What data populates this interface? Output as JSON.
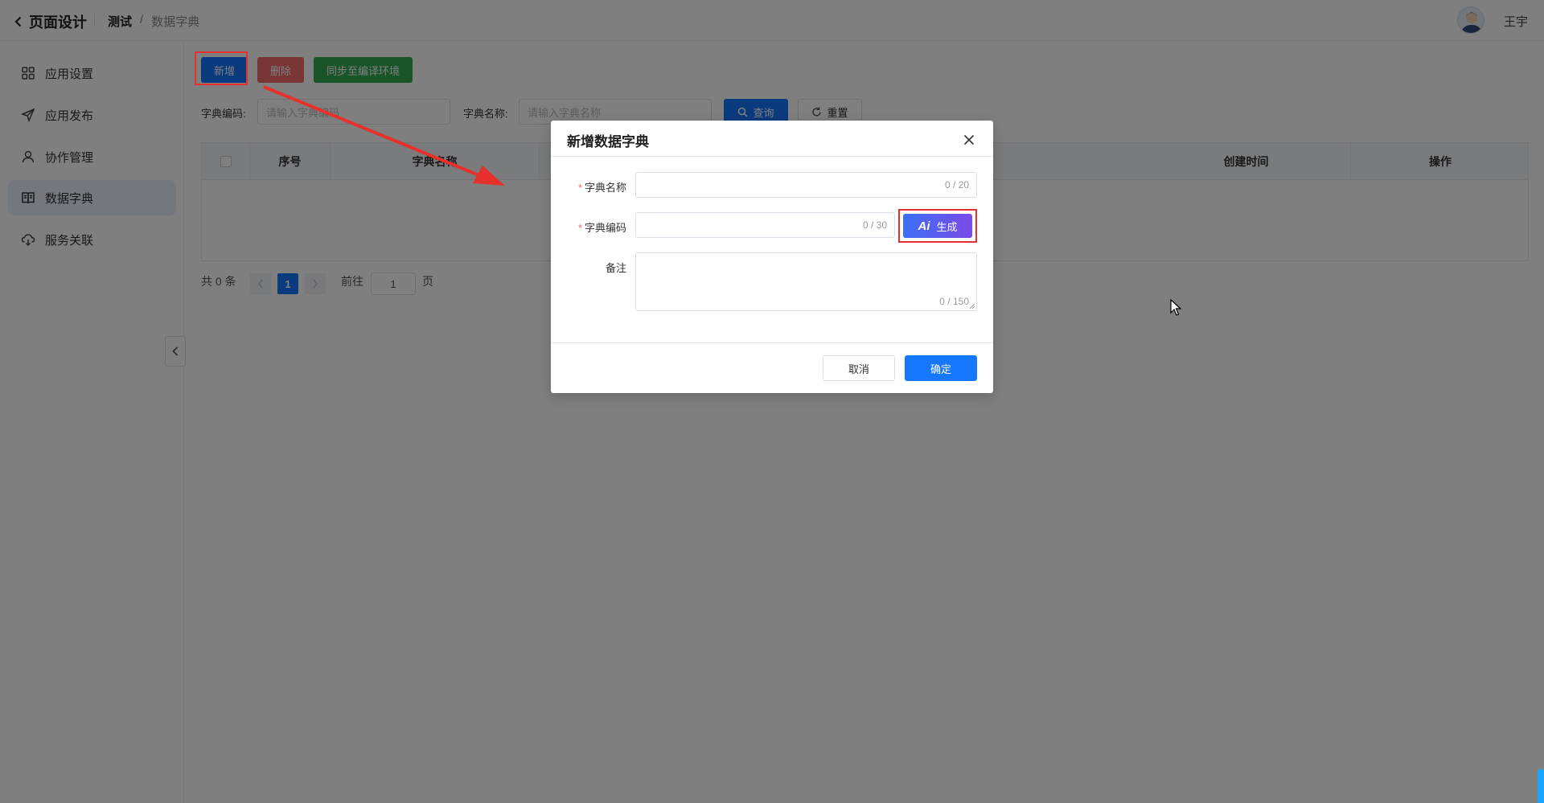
{
  "header": {
    "back_label": "页面设计",
    "breadcrumb": [
      "测试",
      "/",
      "数据字典"
    ],
    "username": "王宇"
  },
  "sidebar": {
    "items": [
      {
        "label": "应用设置",
        "icon": "grid-icon"
      },
      {
        "label": "应用发布",
        "icon": "send-icon"
      },
      {
        "label": "协作管理",
        "icon": "user-icon"
      },
      {
        "label": "数据字典",
        "icon": "book-icon",
        "active": true
      },
      {
        "label": "服务关联",
        "icon": "cloud-icon"
      }
    ]
  },
  "toolbar": {
    "add_label": "新增",
    "delete_label": "删除",
    "sync_label": "同步至编译环境"
  },
  "filters": {
    "code_label": "字典编码:",
    "code_placeholder": "请输入字典编码",
    "name_label": "字典名称:",
    "name_placeholder": "请输入字典名称",
    "search_label": "查询",
    "reset_label": "重置"
  },
  "table": {
    "columns": [
      "序号",
      "字典名称",
      "创建时间",
      "操作"
    ]
  },
  "pagination": {
    "total_text": "共 0 条",
    "current_page": "1",
    "goto_label": "前往",
    "goto_value": "1",
    "page_suffix": "页"
  },
  "modal": {
    "title": "新增数据字典",
    "name_label": "字典名称",
    "name_count": "0 / 20",
    "code_label": "字典编码",
    "code_count": "0 / 30",
    "generate_ai": "Ai",
    "generate_label": "生成",
    "remark_label": "备注",
    "remark_count": "0 / 150",
    "cancel_label": "取消",
    "confirm_label": "确定"
  },
  "colors": {
    "primary": "#1677ff",
    "danger": "#f56c6c",
    "success": "#34a853",
    "highlight_red": "#e5302b"
  }
}
